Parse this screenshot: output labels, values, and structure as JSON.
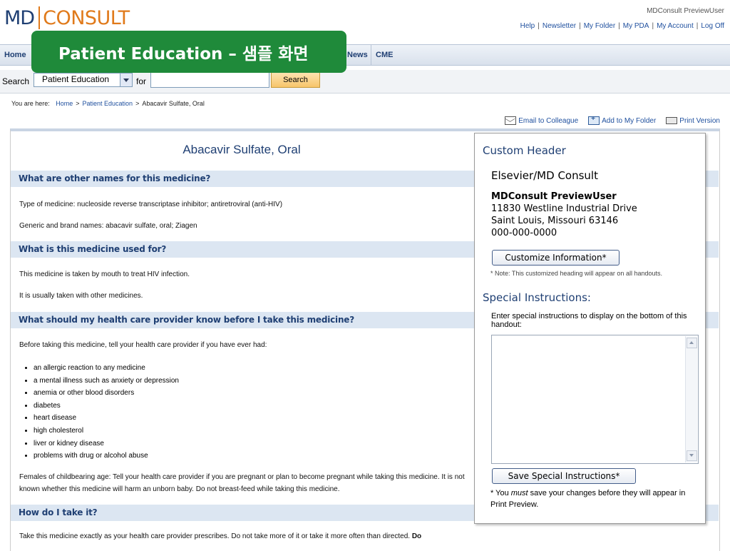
{
  "brand": {
    "md": "MD",
    "consult": "CONSULT"
  },
  "header": {
    "user": "MDConsult PreviewUser",
    "links": [
      "Help",
      "Newsletter",
      "My Folder",
      "My PDA",
      "My Account",
      "Log Off"
    ]
  },
  "nav": {
    "home": "Home",
    "news": "News",
    "cme": "CME"
  },
  "banner": "Patient Education – 샘플 화면",
  "search": {
    "label": "Search",
    "selected": "Patient Education",
    "for": "for",
    "value": "",
    "button": "Search"
  },
  "breadcrumb": {
    "prefix": "You are here:",
    "items": [
      "Home",
      "Patient Education",
      "Abacavir Sulfate, Oral"
    ]
  },
  "actions": {
    "email": "Email to Colleague",
    "folder": "Add to My Folder",
    "print": "Print Version"
  },
  "doc": {
    "title": "Abacavir Sulfate, Oral",
    "sections": [
      "What are other names for this medicine?",
      "What is this medicine used for?",
      "What should my health care provider know before I take this medicine?",
      "How do I take it?"
    ],
    "p_type": "Type of medicine: nucleoside reverse transcriptase inhibitor; antiretroviral (anti-HIV)",
    "p_names": "Generic and brand names: abacavir sulfate, oral; Ziagen",
    "p_used1": "This medicine is taken by mouth to treat HIV infection.",
    "p_used2": "It is usually taken with other medicines.",
    "p_before": "Before taking this medicine, tell your health care provider if you have ever had:",
    "bullets": [
      "an allergic reaction to any medicine",
      "a mental illness such as anxiety or depression",
      "anemia or other blood disorders",
      "diabetes",
      "heart disease",
      "high cholesterol",
      "liver or kidney disease",
      "problems with drug or alcohol abuse"
    ],
    "p_females": "Females of childbearing age: Tell your health care provider if you are pregnant or plan to become pregnant while taking this medicine. It is not known whether this medicine will harm an unborn baby. Do not breast-feed while taking this medicine.",
    "p_take": "Take this medicine exactly as your health care provider prescribes. Do not take more of it or take it more often than directed.",
    "p_take_bold": "Do"
  },
  "side": {
    "custom_header": "Custom Header",
    "org": "Elsevier/MD Consult",
    "user": "MDConsult PreviewUser",
    "addr1": "11830 Westline Industrial Drive",
    "addr2": "Saint Louis, Missouri 63146",
    "phone": "000-000-0000",
    "customize_btn": "Customize Information*",
    "note": "* Note: This customized heading will appear on all handouts.",
    "special_title": "Special Instructions:",
    "special_desc": "Enter special instructions to display on the bottom of this handout:",
    "textarea_value": "",
    "save_btn": "Save Special Instructions*",
    "must_prefix": "* You ",
    "must_em": "must",
    "must_suffix": " save your changes before they will appear in Print Preview."
  }
}
